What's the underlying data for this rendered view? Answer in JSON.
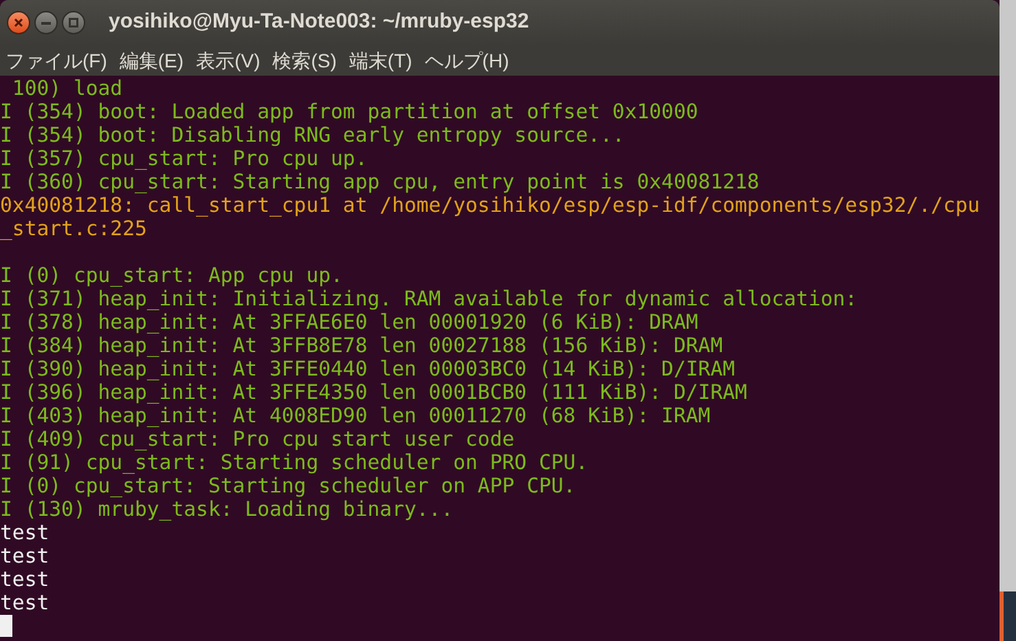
{
  "window": {
    "title": "yosihiko@Myu-Ta-Note003: ~/mruby-esp32"
  },
  "menu": [
    "ファイル(F)",
    "編集(E)",
    "表示(V)",
    "検索(S)",
    "端末(T)",
    "ヘルプ(H)"
  ],
  "terminal": {
    "lines": [
      {
        "kind": "info",
        "text": " 100) load"
      },
      {
        "kind": "info",
        "text": "I (354) boot: Loaded app from partition at offset 0x10000"
      },
      {
        "kind": "info",
        "text": "I (354) boot: Disabling RNG early entropy source..."
      },
      {
        "kind": "info",
        "text": "I (357) cpu_start: Pro cpu up."
      },
      {
        "kind": "info",
        "text": "I (360) cpu_start: Starting app cpu, entry point is 0x40081218"
      },
      {
        "kind": "address",
        "text": "0x40081218: call_start_cpu1 at /home/yosihiko/esp/esp-idf/components/esp32/./cpu"
      },
      {
        "kind": "address",
        "text": "_start.c:225"
      },
      {
        "kind": "blank"
      },
      {
        "kind": "info",
        "text": "I (0) cpu_start: App cpu up."
      },
      {
        "kind": "info",
        "text": "I (371) heap_init: Initializing. RAM available for dynamic allocation:"
      },
      {
        "kind": "info",
        "text": "I (378) heap_init: At 3FFAE6E0 len 00001920 (6 KiB): DRAM"
      },
      {
        "kind": "info",
        "text": "I (384) heap_init: At 3FFB8E78 len 00027188 (156 KiB): DRAM"
      },
      {
        "kind": "info",
        "text": "I (390) heap_init: At 3FFE0440 len 00003BC0 (14 KiB): D/IRAM"
      },
      {
        "kind": "info",
        "text": "I (396) heap_init: At 3FFE4350 len 0001BCB0 (111 KiB): D/IRAM"
      },
      {
        "kind": "info",
        "text": "I (403) heap_init: At 4008ED90 len 00011270 (68 KiB): IRAM"
      },
      {
        "kind": "info",
        "text": "I (409) cpu_start: Pro cpu start user code"
      },
      {
        "kind": "info",
        "text": "I (91) cpu_start: Starting scheduler on PRO CPU."
      },
      {
        "kind": "info",
        "text": "I (0) cpu_start: Starting scheduler on APP CPU."
      },
      {
        "kind": "info",
        "text": "I (130) mruby_task: Loading binary..."
      },
      {
        "kind": "plain",
        "text": "test"
      },
      {
        "kind": "plain",
        "text": "test"
      },
      {
        "kind": "plain",
        "text": "test"
      },
      {
        "kind": "plain",
        "text": "test"
      }
    ]
  }
}
